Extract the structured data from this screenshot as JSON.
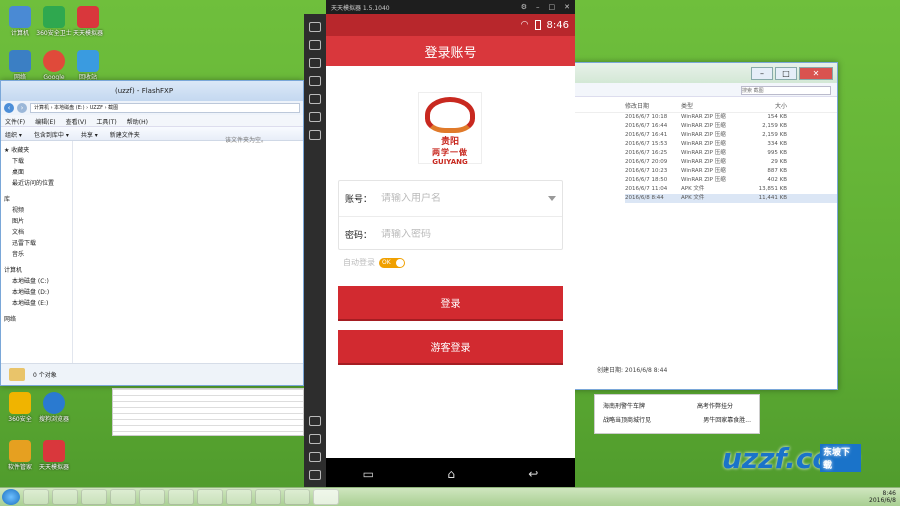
{
  "desktop": {
    "icons": [
      {
        "label": "计算机"
      },
      {
        "label": "360安全卫士"
      },
      {
        "label": "天天模拟器"
      },
      {
        "label": "网络"
      },
      {
        "label": "Google"
      },
      {
        "label": "回收站"
      },
      {
        "label": "360安全"
      },
      {
        "label": "搜狗浏览器"
      },
      {
        "label": "软件管家"
      },
      {
        "label": "天天模拟器"
      }
    ]
  },
  "explorer": {
    "title": "(uzzf) - FlashFXP",
    "breadcrumb": "计算机 › 本地磁盘 (E:) › UZZF › 截图",
    "search_placeholder": "搜索 截图",
    "menu": [
      "文件(F)",
      "编辑(E)",
      "查看(V)",
      "工具(T)",
      "帮助(H)"
    ],
    "toolbar": [
      "组织 ▾",
      "包含到库中 ▾",
      "共享 ▾",
      "新建文件夹"
    ],
    "empty_text": "该文件夹为空。",
    "nav": [
      "★ 收藏夹",
      "下载",
      "桌面",
      "最近访问的位置",
      "库",
      "视频",
      "图片",
      "文档",
      "迅雷下载",
      "音乐",
      "计算机",
      "本地磁盘 (C:)",
      "本地磁盘 (D:)",
      "本地磁盘 (E:)",
      "网络"
    ],
    "status_count": "0 个对象"
  },
  "filelist": {
    "headers": [
      "修改日期",
      "类型",
      "大小"
    ],
    "rows": [
      {
        "date": "2016/6/7 10:18",
        "type": "WinRAR ZIP 压缩",
        "size": "154 KB"
      },
      {
        "date": "2016/6/7 16:44",
        "type": "WinRAR ZIP 压缩",
        "size": "2,159 KB"
      },
      {
        "date": "2016/6/7 16:41",
        "type": "WinRAR ZIP 压缩",
        "size": "2,159 KB"
      },
      {
        "date": "2016/6/7 15:53",
        "type": "WinRAR ZIP 压缩",
        "size": "334 KB"
      },
      {
        "date": "2016/6/7 16:25",
        "type": "WinRAR ZIP 压缩",
        "size": "995 KB"
      },
      {
        "date": "2016/6/7 20:09",
        "type": "WinRAR ZIP 压缩",
        "size": "29 KB"
      },
      {
        "date": "2016/6/7 10:23",
        "type": "WinRAR ZIP 压缩",
        "size": "887 KB"
      },
      {
        "date": "2016/6/7 18:50",
        "type": "WinRAR ZIP 压缩",
        "size": "402 KB"
      },
      {
        "date": "2016/6/7 11:04",
        "type": "APK 文件",
        "size": "13,851 KB"
      },
      {
        "date": "2016/6/8 8:44",
        "type": "APK 文件",
        "size": "11,441 KB"
      }
    ],
    "created": "创建日期: 2016/6/8 8:44",
    "news": [
      "海南刑警牛车牌",
      "高考作弊挂分",
      "战略当顶商城行见",
      "男牛回家靠食胜..."
    ]
  },
  "emulator": {
    "title": "天天模拟器 1.5.1040",
    "clock": "8:46",
    "app_title": "登录账号",
    "logo_cn": "贵阳",
    "logo_cn2": "两学一做",
    "logo_en": "GUIYANG",
    "username_label": "账号：",
    "username_placeholder": "请输入用户名",
    "password_label": "密码：",
    "password_placeholder": "请输入密码",
    "auto_login": "自动登录",
    "toggle_text": "OK",
    "login_button": "登录",
    "guest_button": "游客登录"
  },
  "taskbar": {
    "time": "8:46",
    "date": "2016/6/8"
  },
  "watermark": {
    "text": "uzzf.com",
    "tag": "东坡下载"
  }
}
